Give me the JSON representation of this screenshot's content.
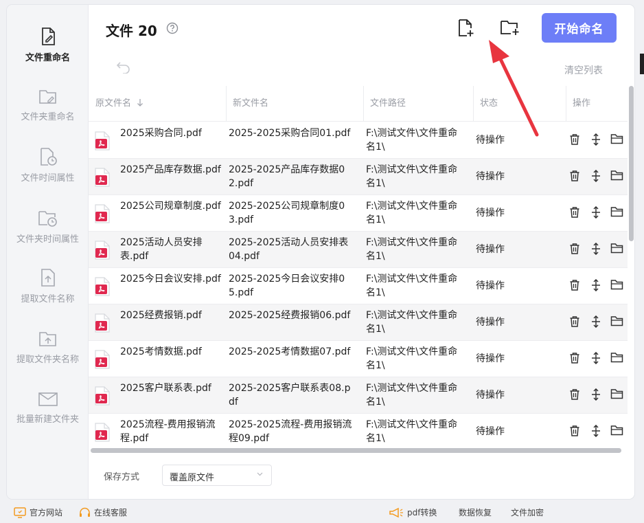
{
  "title": "文件 20",
  "toolbar": {
    "start_label": "开始命名",
    "clear_label": "清空列表"
  },
  "sidebar": {
    "items": [
      {
        "label": "文件重命名",
        "icon": "file-rename-icon",
        "active": true
      },
      {
        "label": "文件夹重命名",
        "icon": "folder-rename-icon",
        "active": false
      },
      {
        "label": "文件时间属性",
        "icon": "file-clock-icon",
        "active": false
      },
      {
        "label": "文件夹时间属性",
        "icon": "folder-clock-icon",
        "active": false
      },
      {
        "label": "提取文件名称",
        "icon": "file-extract-icon",
        "active": false
      },
      {
        "label": "提取文件夹名称",
        "icon": "folder-extract-icon",
        "active": false
      },
      {
        "label": "批量新建文件夹",
        "icon": "folder-create-icon",
        "active": false
      }
    ]
  },
  "table": {
    "columns": [
      "原文件名",
      "新文件名",
      "文件路径",
      "状态",
      "操作"
    ],
    "rows": [
      {
        "orig": "2025采购合同.pdf",
        "new": "2025-2025采购合同01.pdf",
        "path": "F:\\测试文件\\文件重命名1\\",
        "status": "待操作"
      },
      {
        "orig": "2025产品库存数据.pdf",
        "new": "2025-2025产品库存数据02.pdf",
        "path": "F:\\测试文件\\文件重命名1\\",
        "status": "待操作"
      },
      {
        "orig": "2025公司规章制度.pdf",
        "new": "2025-2025公司规章制度03.pdf",
        "path": "F:\\测试文件\\文件重命名1\\",
        "status": "待操作"
      },
      {
        "orig": "2025活动人员安排表.pdf",
        "new": "2025-2025活动人员安排表04.pdf",
        "path": "F:\\测试文件\\文件重命名1\\",
        "status": "待操作"
      },
      {
        "orig": "2025今日会议安排.pdf",
        "new": "2025-2025今日会议安排05.pdf",
        "path": "F:\\测试文件\\文件重命名1\\",
        "status": "待操作"
      },
      {
        "orig": "2025经费报销.pdf",
        "new": "2025-2025经费报销06.pdf",
        "path": "F:\\测试文件\\文件重命名1\\",
        "status": "待操作"
      },
      {
        "orig": "2025考情数据.pdf",
        "new": "2025-2025考情数据07.pdf",
        "path": "F:\\测试文件\\文件重命名1\\",
        "status": "待操作"
      },
      {
        "orig": "2025客户联系表.pdf",
        "new": "2025-2025客户联系表08.pdf",
        "path": "F:\\测试文件\\文件重命名1\\",
        "status": "待操作"
      },
      {
        "orig": "2025流程-费用报销流程.pdf",
        "new": "2025-2025流程-费用报销流程09.pdf",
        "path": "F:\\测试文件\\文件重命名1\\",
        "status": "待操作"
      }
    ]
  },
  "save": {
    "label": "保存方式",
    "value": "覆盖原文件"
  },
  "footer": {
    "website": "官方网站",
    "support": "在线客服",
    "pdf": "pdf转换",
    "recovery": "数据恢复",
    "encrypt": "文件加密"
  },
  "colors": {
    "accent": "#6d7ef7",
    "pdf_red": "#e0284f",
    "arrow_red": "#e8353f"
  }
}
